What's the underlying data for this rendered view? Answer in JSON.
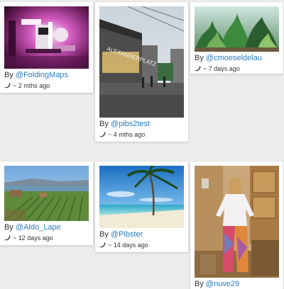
{
  "cards": [
    {
      "by_prefix": "By ",
      "user": "@FoldingMaps",
      "time": "~ 2 mths ago",
      "image": "photo-robot-purple-light"
    },
    {
      "by_prefix": "By ",
      "user": "@pibs2test",
      "time": "~ 4 mths ago",
      "image": "photo-alexanderplatz-station"
    },
    {
      "by_prefix": "By ",
      "user": "@cmoeseldelau",
      "time": "~ 7 days ago",
      "image": "photo-aquarium-plants"
    },
    {
      "by_prefix": "By ",
      "user": "@Aldo_Lape",
      "time": "~ 12 days ago",
      "image": "photo-vineyard-lake"
    },
    {
      "by_prefix": "By ",
      "user": "@Pibster",
      "time": "~ 14 days ago",
      "image": "photo-palm-beach"
    },
    {
      "by_prefix": "By ",
      "user": "@nuve29",
      "time": "",
      "image": "photo-woman-costume"
    }
  ],
  "sign": {
    "text": "ALEXANDERPLATZ"
  },
  "icons": {
    "time_icon": "twitter-bird-icon"
  },
  "colors": {
    "link": "#2a7bbf",
    "background": "#ececec",
    "card": "#ffffff"
  }
}
